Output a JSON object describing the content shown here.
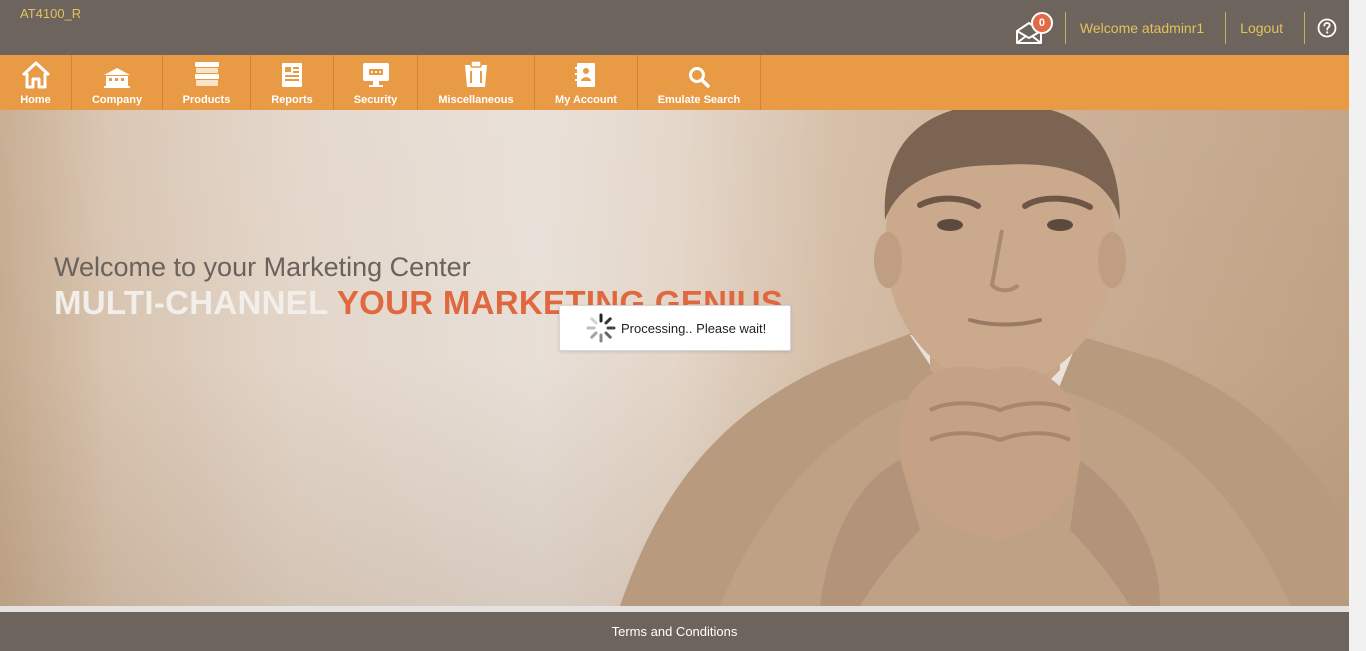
{
  "header": {
    "site_code": "AT4100_R",
    "mail_count": "0",
    "welcome": "Welcome atadminr1",
    "logout": "Logout",
    "help_icon": "question-circle-icon"
  },
  "nav": {
    "items": [
      {
        "label": "Home",
        "icon": "home-icon"
      },
      {
        "label": "Company",
        "icon": "building-icon"
      },
      {
        "label": "Products",
        "icon": "stack-icon"
      },
      {
        "label": "Reports",
        "icon": "report-icon"
      },
      {
        "label": "Security",
        "icon": "monitor-lock-icon"
      },
      {
        "label": "Miscellaneous",
        "icon": "clipboard-icon"
      },
      {
        "label": "My Account",
        "icon": "contact-book-icon"
      },
      {
        "label": "Emulate Search",
        "icon": "search-icon"
      }
    ]
  },
  "hero": {
    "line1": "Welcome to your Marketing Center",
    "line2_white": "MULTI-CHANNEL",
    "line2_orange": "YOUR MARKETING GENIUS"
  },
  "processing": {
    "text": "Processing.. Please wait!"
  },
  "footer": {
    "terms": "Terms and Conditions"
  },
  "colors": {
    "header_bg": "#6d645e",
    "nav_bg": "#e89a44",
    "accent_text": "#e2c25a",
    "headline_orange": "#e0683f"
  }
}
